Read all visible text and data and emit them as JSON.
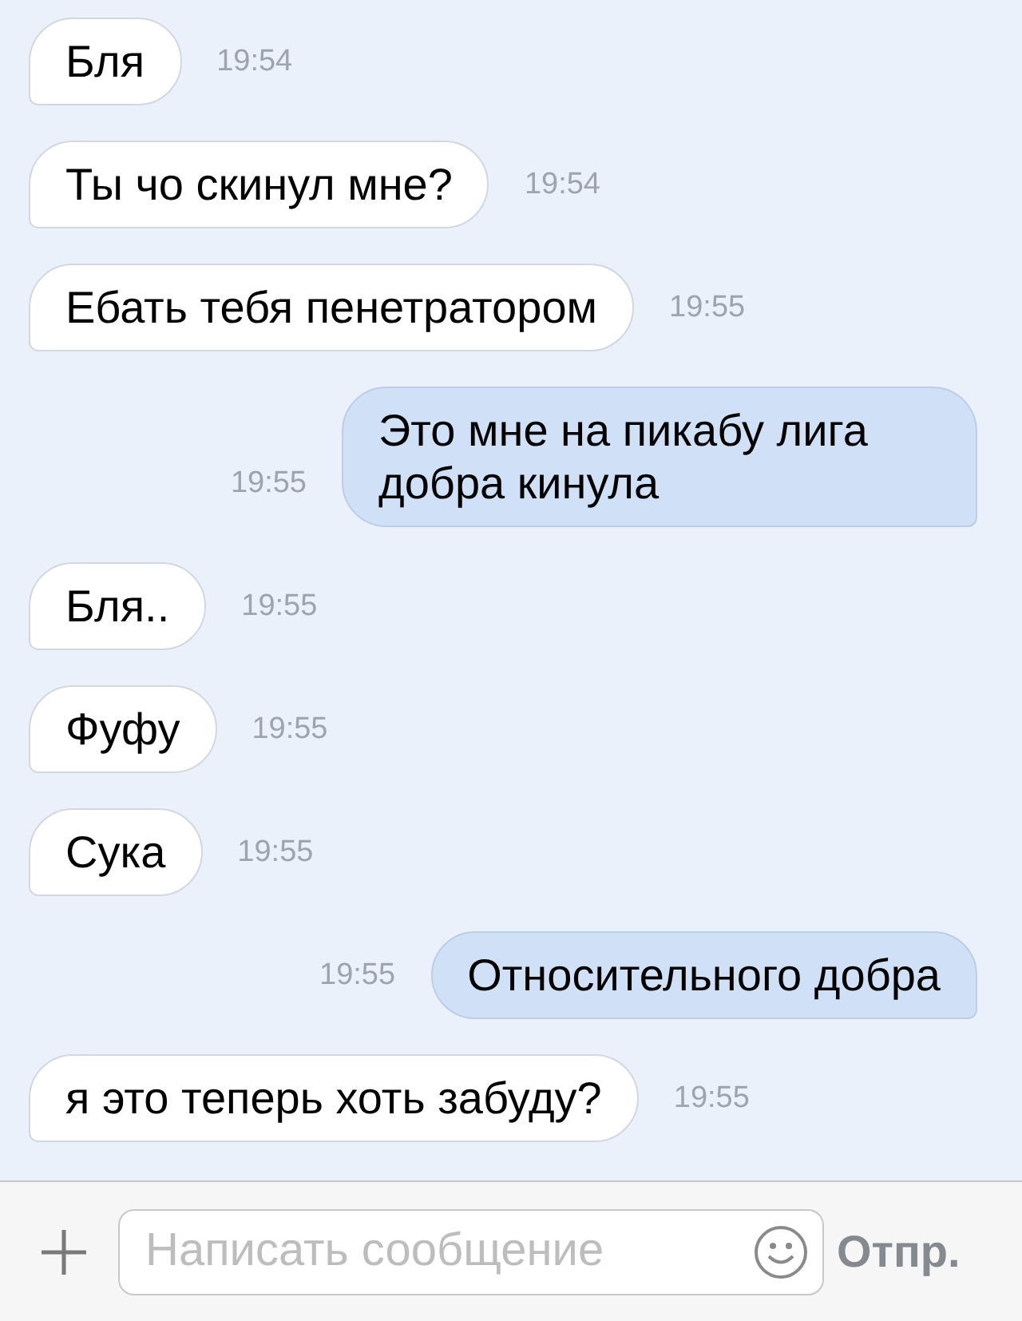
{
  "messages": [
    {
      "kind": "incoming",
      "text": "Бля",
      "time": "19:54"
    },
    {
      "kind": "incoming",
      "text": "Ты чо скинул мне?",
      "time": "19:54"
    },
    {
      "kind": "incoming",
      "text": "Ебать тебя пенетратором",
      "time": "19:55"
    },
    {
      "kind": "outgoing",
      "text": "Это мне на пикабу лига добра кинула",
      "time": "19:55"
    },
    {
      "kind": "incoming",
      "text": "Бля..",
      "time": "19:55"
    },
    {
      "kind": "incoming",
      "text": "Фуфу",
      "time": "19:55"
    },
    {
      "kind": "incoming",
      "text": "Сука",
      "time": "19:55"
    },
    {
      "kind": "outgoing",
      "text": "Относительного добра",
      "time": "19:55"
    },
    {
      "kind": "incoming",
      "text": "я это теперь хоть забуду?",
      "time": "19:55"
    }
  ],
  "composer": {
    "placeholder": "Написать сообщение",
    "send_label": "Отпр."
  }
}
